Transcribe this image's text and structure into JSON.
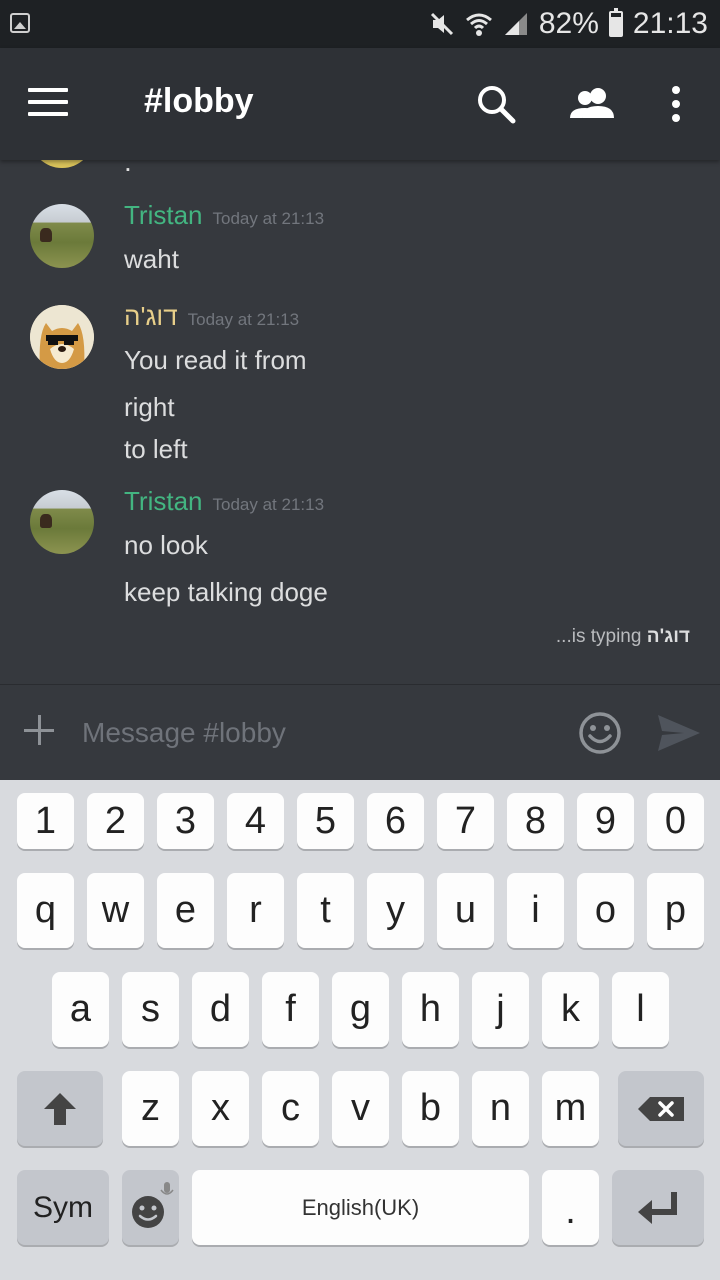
{
  "status_bar": {
    "battery_text": "82%",
    "battery_level": 0.82,
    "time": "21:13",
    "icons": [
      "gallery-icon",
      "mute-icon",
      "wifi-icon",
      "signal-icon",
      "battery-icon"
    ]
  },
  "app_bar": {
    "channel_title": "#lobby",
    "icons": [
      "menu-icon",
      "search-icon",
      "members-icon",
      "overflow-icon"
    ]
  },
  "chat": {
    "partial_message_text": ":",
    "messages": [
      {
        "author": "Tristan",
        "author_color": "#43b581",
        "timestamp": "Today at 21:13",
        "lines": [
          "waht"
        ]
      },
      {
        "author": "דוג'ה",
        "author_color": "#e8cf8a",
        "timestamp": "Today at 21:13",
        "lines": [
          "You read it from",
          "right",
          "to left"
        ]
      },
      {
        "author": "Tristan",
        "author_color": "#43b581",
        "timestamp": "Today at 21:13",
        "lines": [
          "no look",
          "keep talking doge"
        ]
      }
    ],
    "typing": {
      "name": "דוג'ה",
      "suffix": "...is typing"
    }
  },
  "composer": {
    "placeholder": "Message #lobby",
    "value": ""
  },
  "keyboard": {
    "row_numbers": [
      "1",
      "2",
      "3",
      "4",
      "5",
      "6",
      "7",
      "8",
      "9",
      "0"
    ],
    "row_1": [
      "q",
      "w",
      "e",
      "r",
      "t",
      "y",
      "u",
      "i",
      "o",
      "p"
    ],
    "row_2": [
      "a",
      "s",
      "d",
      "f",
      "g",
      "h",
      "j",
      "k",
      "l"
    ],
    "row_3": [
      "z",
      "x",
      "c",
      "v",
      "b",
      "n",
      "m"
    ],
    "sym_label": "Sym",
    "space_label": "English(UK)",
    "period_label": "."
  }
}
